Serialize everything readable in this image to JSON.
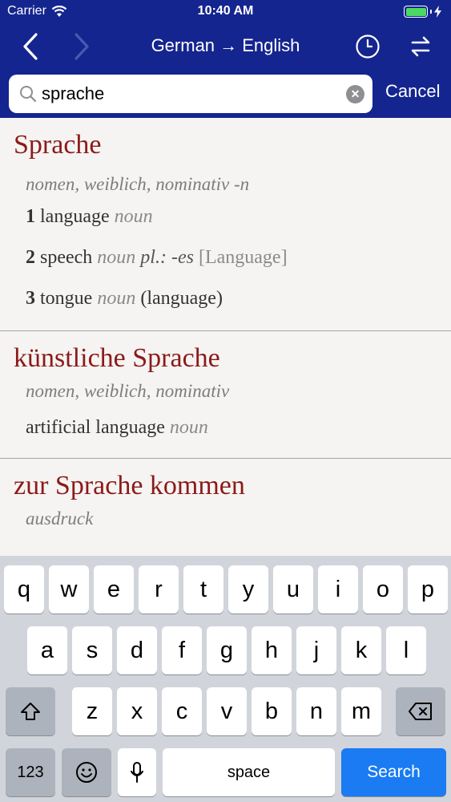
{
  "status": {
    "carrier": "Carrier",
    "time": "10:40 AM"
  },
  "nav": {
    "title": "German → English"
  },
  "search": {
    "value": "sprache",
    "cancel": "Cancel"
  },
  "entries": [
    {
      "headword": "Sprache",
      "grammar": "nomen, weiblich, nominativ",
      "grammar_suffix": " -n",
      "senses": [
        {
          "num": "1",
          "text": "language",
          "pos": "noun"
        },
        {
          "num": "2",
          "text": "speech",
          "pos": "noun",
          "plural": "pl.: -es",
          "label": "[Language]"
        },
        {
          "num": "3",
          "text": "tongue",
          "pos": "noun",
          "note": "(language)"
        }
      ]
    },
    {
      "headword": "künstliche Sprache",
      "grammar": "nomen, weiblich, nominativ",
      "senses": [
        {
          "text": "artificial language",
          "pos": "noun"
        }
      ]
    },
    {
      "headword": "zur Sprache kommen",
      "grammar": "ausdruck"
    }
  ],
  "keyboard": {
    "row1": [
      "q",
      "w",
      "e",
      "r",
      "t",
      "y",
      "u",
      "i",
      "o",
      "p"
    ],
    "row2": [
      "a",
      "s",
      "d",
      "f",
      "g",
      "h",
      "j",
      "k",
      "l"
    ],
    "row3": [
      "z",
      "x",
      "c",
      "v",
      "b",
      "n",
      "m"
    ],
    "numbers": "123",
    "space": "space",
    "search": "Search"
  },
  "colors": {
    "bar": "#14258f",
    "headword": "#8b1a1a",
    "search_key": "#1a7bf2"
  }
}
